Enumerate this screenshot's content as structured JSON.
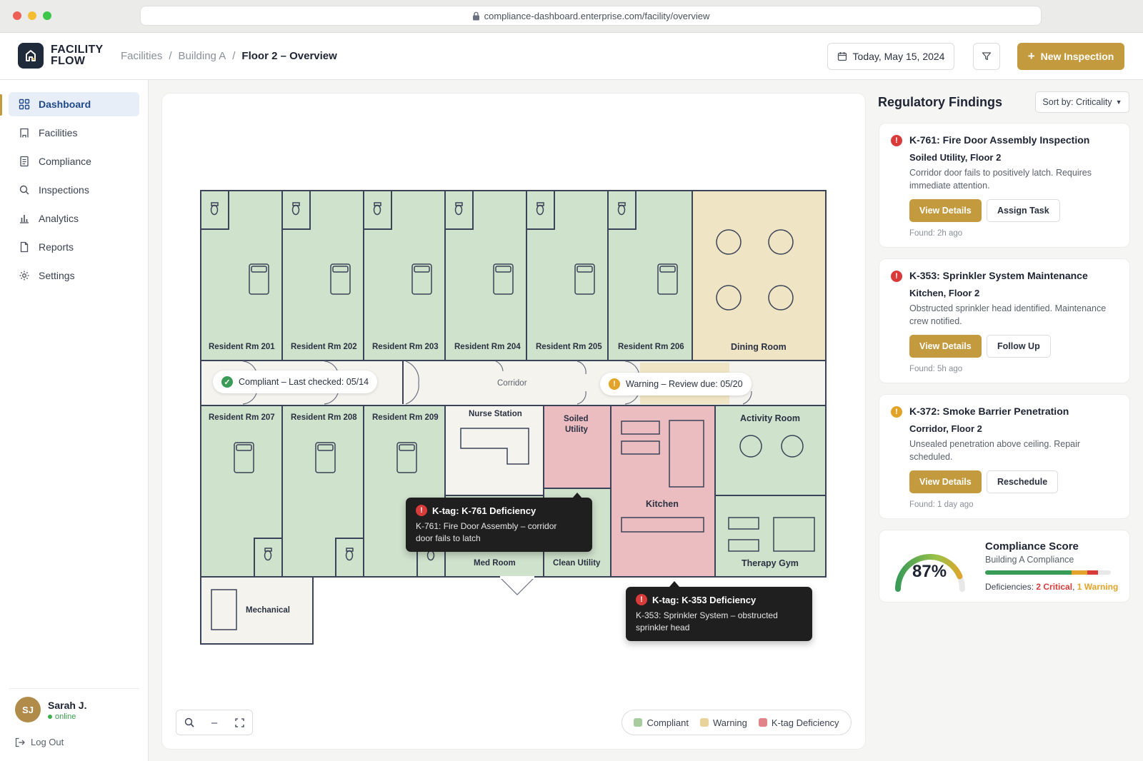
{
  "browser": {
    "url": "compliance-dashboard.enterprise.com/facility/overview"
  },
  "brand": {
    "name_line1": "FACILITY",
    "name_line2": "FLOW"
  },
  "breadcrumb": {
    "items": [
      "Facilities",
      "Building A"
    ],
    "current": "Floor 2 – Overview",
    "separator": "/"
  },
  "header": {
    "date_label": "Today, May 15, 2024",
    "new_button_label": "New Inspection",
    "new_button_plus": "+"
  },
  "sidebar": {
    "items": [
      {
        "label": "Dashboard",
        "icon": "grid-icon"
      },
      {
        "label": "Facilities",
        "icon": "building-icon"
      },
      {
        "label": "Compliance",
        "icon": "clipboard-icon"
      },
      {
        "label": "Inspections",
        "icon": "search-icon"
      },
      {
        "label": "Analytics",
        "icon": "bar-chart-icon"
      },
      {
        "label": "Reports",
        "icon": "file-icon"
      },
      {
        "label": "Settings",
        "icon": "gear-icon"
      }
    ],
    "user": {
      "initials": "SJ",
      "name": "Sarah J.",
      "status": "online"
    },
    "logout": "Log Out"
  },
  "floorplan": {
    "rooms": {
      "r201": "Resident Rm 201",
      "r202": "Resident Rm 202",
      "r203": "Resident Rm 203",
      "r204": "Resident Rm 204",
      "r205": "Resident Rm 205",
      "r206": "Resident Rm 206",
      "dining": "Dining Room",
      "corridor": "Corridor",
      "r207": "Resident Rm 207",
      "r208": "Resident Rm 208",
      "r209": "Resident Rm 209",
      "nurse": "Nurse Station",
      "soiled1": "Soiled",
      "soiled2": "Utility",
      "kitchen": "Kitchen",
      "activity": "Activity Room",
      "med": "Med Room",
      "clean": "Clean Utility",
      "therapy": "Therapy Gym",
      "mechanical": "Mechanical"
    },
    "chips": {
      "compliant": "Compliant – Last checked: 05/14",
      "warning": "Warning – Review due: 05/20"
    },
    "tooltips": [
      {
        "title": "K-tag: K-761 Deficiency",
        "line1": "K-761: Fire Door Assembly – corridor",
        "line2": "door fails to latch"
      },
      {
        "title": "K-tag: K-353 Deficiency",
        "line1": "K-353: Sprinkler System – obstructed",
        "line2": "sprinkler head"
      }
    ],
    "zoom_minus": "–",
    "legend": [
      {
        "label": "Compliant",
        "color": "#a9cc9f"
      },
      {
        "label": "Warning",
        "color": "#e8d49b"
      },
      {
        "label": "K-tag Deficiency",
        "color": "#e1848a"
      }
    ],
    "colors": {
      "compliant": "#cfe2cc",
      "warning": "#efe4c4",
      "deficiency": "#ebbdc0",
      "wall": "#3b4358"
    }
  },
  "findings": {
    "title": "Regulatory Findings",
    "sort_label": "Sort by: Criticality",
    "cards": [
      {
        "severity": "critical",
        "title": "K-761: Fire Door Assembly Inspection",
        "location": "Soiled Utility, Floor 2",
        "desc": "Corridor door fails to positively latch. Requires immediate attention.",
        "primary": "View Details",
        "secondary": "Assign Task",
        "found": "Found: 2h ago"
      },
      {
        "severity": "critical",
        "title": "K-353: Sprinkler System Maintenance",
        "location": "Kitchen, Floor 2",
        "desc": "Obstructed sprinkler head identified. Maintenance crew notified.",
        "primary": "View Details",
        "secondary": "Follow Up",
        "found": "Found: 5h ago"
      },
      {
        "severity": "warning",
        "title": "K-372: Smoke Barrier Penetration",
        "location": "Corridor, Floor 2",
        "desc": "Unsealed penetration above ceiling. Repair scheduled.",
        "primary": "View Details",
        "secondary": "Reschedule",
        "found": "Found: 1 day ago"
      }
    ]
  },
  "score": {
    "title": "Compliance Score",
    "subtitle": "Building A Compliance",
    "value": "87%",
    "fraction": 0.87,
    "deficiencies_label": "Deficiencies:",
    "critical_text": "2 Critical",
    "separator": ",",
    "warning_text": "1 Warning",
    "colors": {
      "critical": "#d93a3a",
      "warning": "#e2a328",
      "ok": "#3a9b56"
    }
  }
}
